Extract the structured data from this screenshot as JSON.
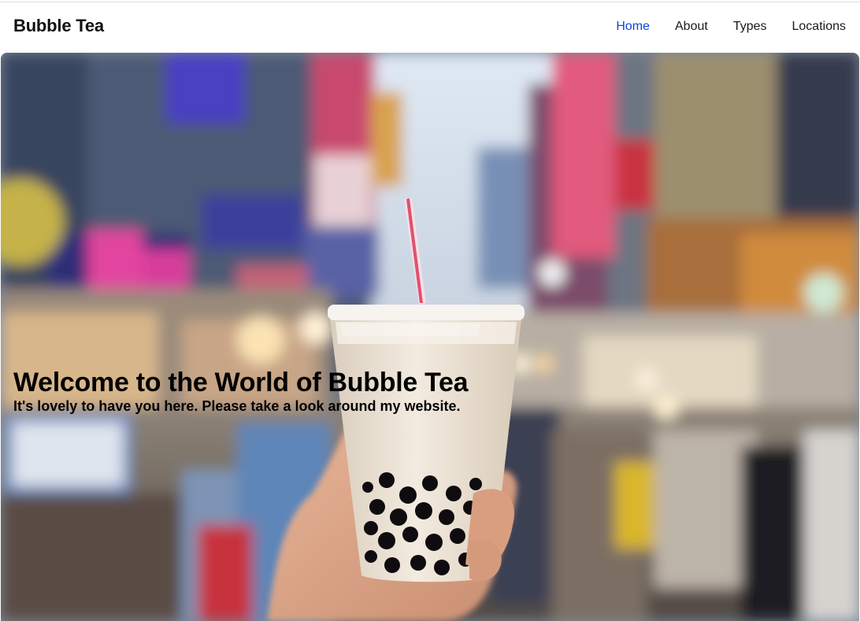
{
  "brand": {
    "name": "Bubble Tea"
  },
  "nav": {
    "items": [
      {
        "label": "Home",
        "active": true
      },
      {
        "label": "About",
        "active": false
      },
      {
        "label": "Types",
        "active": false
      },
      {
        "label": "Locations",
        "active": false
      }
    ]
  },
  "hero": {
    "title": "Welcome to the World of Bubble Tea",
    "subtitle": "It's lovely to have you here. Please take a look around my website.",
    "image": "bubble-tea-night-market-photo"
  },
  "colors": {
    "active_link": "#0d47d9",
    "text": "#111111"
  }
}
